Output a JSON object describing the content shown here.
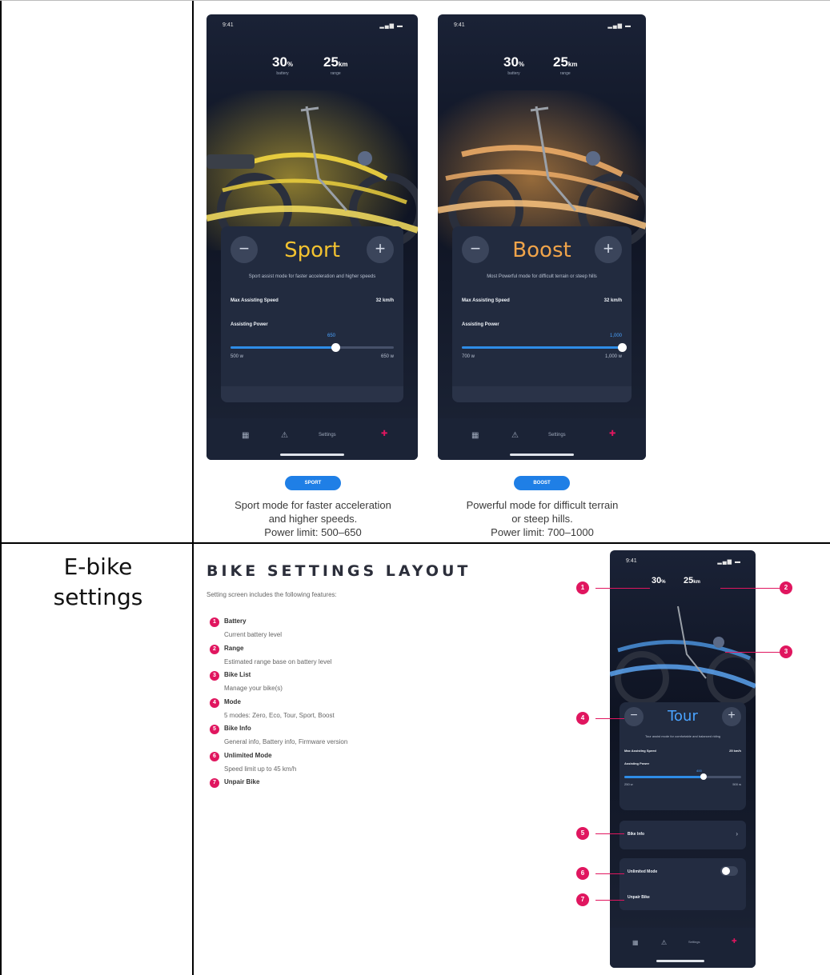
{
  "rows": [
    {
      "label": ""
    },
    {
      "label": "E-bike\nsettings"
    }
  ],
  "phone_common": {
    "time": "9:41",
    "signal": "▂▄▆ ▬",
    "battery": {
      "value": "30",
      "unit": "%",
      "label": "battery"
    },
    "range": {
      "value": "25",
      "unit": "km",
      "label": "range"
    },
    "max_speed_label": "Max Assisting Speed",
    "power_label": "Assisting Power",
    "nav_active": "Settings"
  },
  "sport": {
    "mode": "Sport",
    "description": "Sport assist mode for faster acceleration and higher speeds",
    "max_speed": "32 km/h",
    "power_value": "650",
    "power_min": "500 w",
    "power_max": "650 w",
    "power_fraction": 0.64,
    "accent": "#f2c230",
    "pill": "SPORT",
    "caption": [
      "Sport mode for faster acceleration",
      "and higher speeds.",
      "Power limit: 500–650"
    ]
  },
  "boost": {
    "mode": "Boost",
    "description": "Most Powerful mode for difficult terrain or steep hills",
    "max_speed": "32 km/h",
    "power_value": "1,000",
    "power_min": "700 w",
    "power_max": "1,000 w",
    "power_fraction": 1.0,
    "accent": "#f0a44a",
    "pill": "BOOST",
    "caption": [
      "Powerful mode for difficult terrain",
      "or steep hills.",
      "Power limit: 700–1000"
    ]
  },
  "layout": {
    "header": "BIKE SETTINGS LAYOUT",
    "intro": "Setting screen includes the following features:",
    "items": [
      {
        "num": "1",
        "title": "Battery",
        "desc": "Current battery level"
      },
      {
        "num": "2",
        "title": "Range",
        "desc": "Estimated range base on battery level"
      },
      {
        "num": "3",
        "title": "Bike List",
        "desc": "Manage your bike(s)"
      },
      {
        "num": "4",
        "title": "Mode",
        "desc": "5 modes: Zero, Eco, Tour, Sport, Boost"
      },
      {
        "num": "5",
        "title": "Bike Info",
        "desc": "General info, Battery info, Firmware version"
      },
      {
        "num": "6",
        "title": "Unlimited Mode",
        "desc": "Speed limit up to 45 km/h"
      },
      {
        "num": "7",
        "title": "Unpair Bike",
        "desc": ""
      }
    ]
  },
  "tour": {
    "mode": "Tour",
    "description": "Tour assist mode for comfortable and balanced riding",
    "max_speed": "25 km/h",
    "power_value": "400",
    "power_min": "250 w",
    "power_max": "500 w",
    "power_fraction": 0.68,
    "accent": "#4aa3ff",
    "bike_info": "Bike Info",
    "unlimited": "Unlimited Mode",
    "unpair": "Unpair Bike",
    "callouts": [
      "1",
      "2",
      "3",
      "4",
      "5",
      "6",
      "7"
    ]
  }
}
